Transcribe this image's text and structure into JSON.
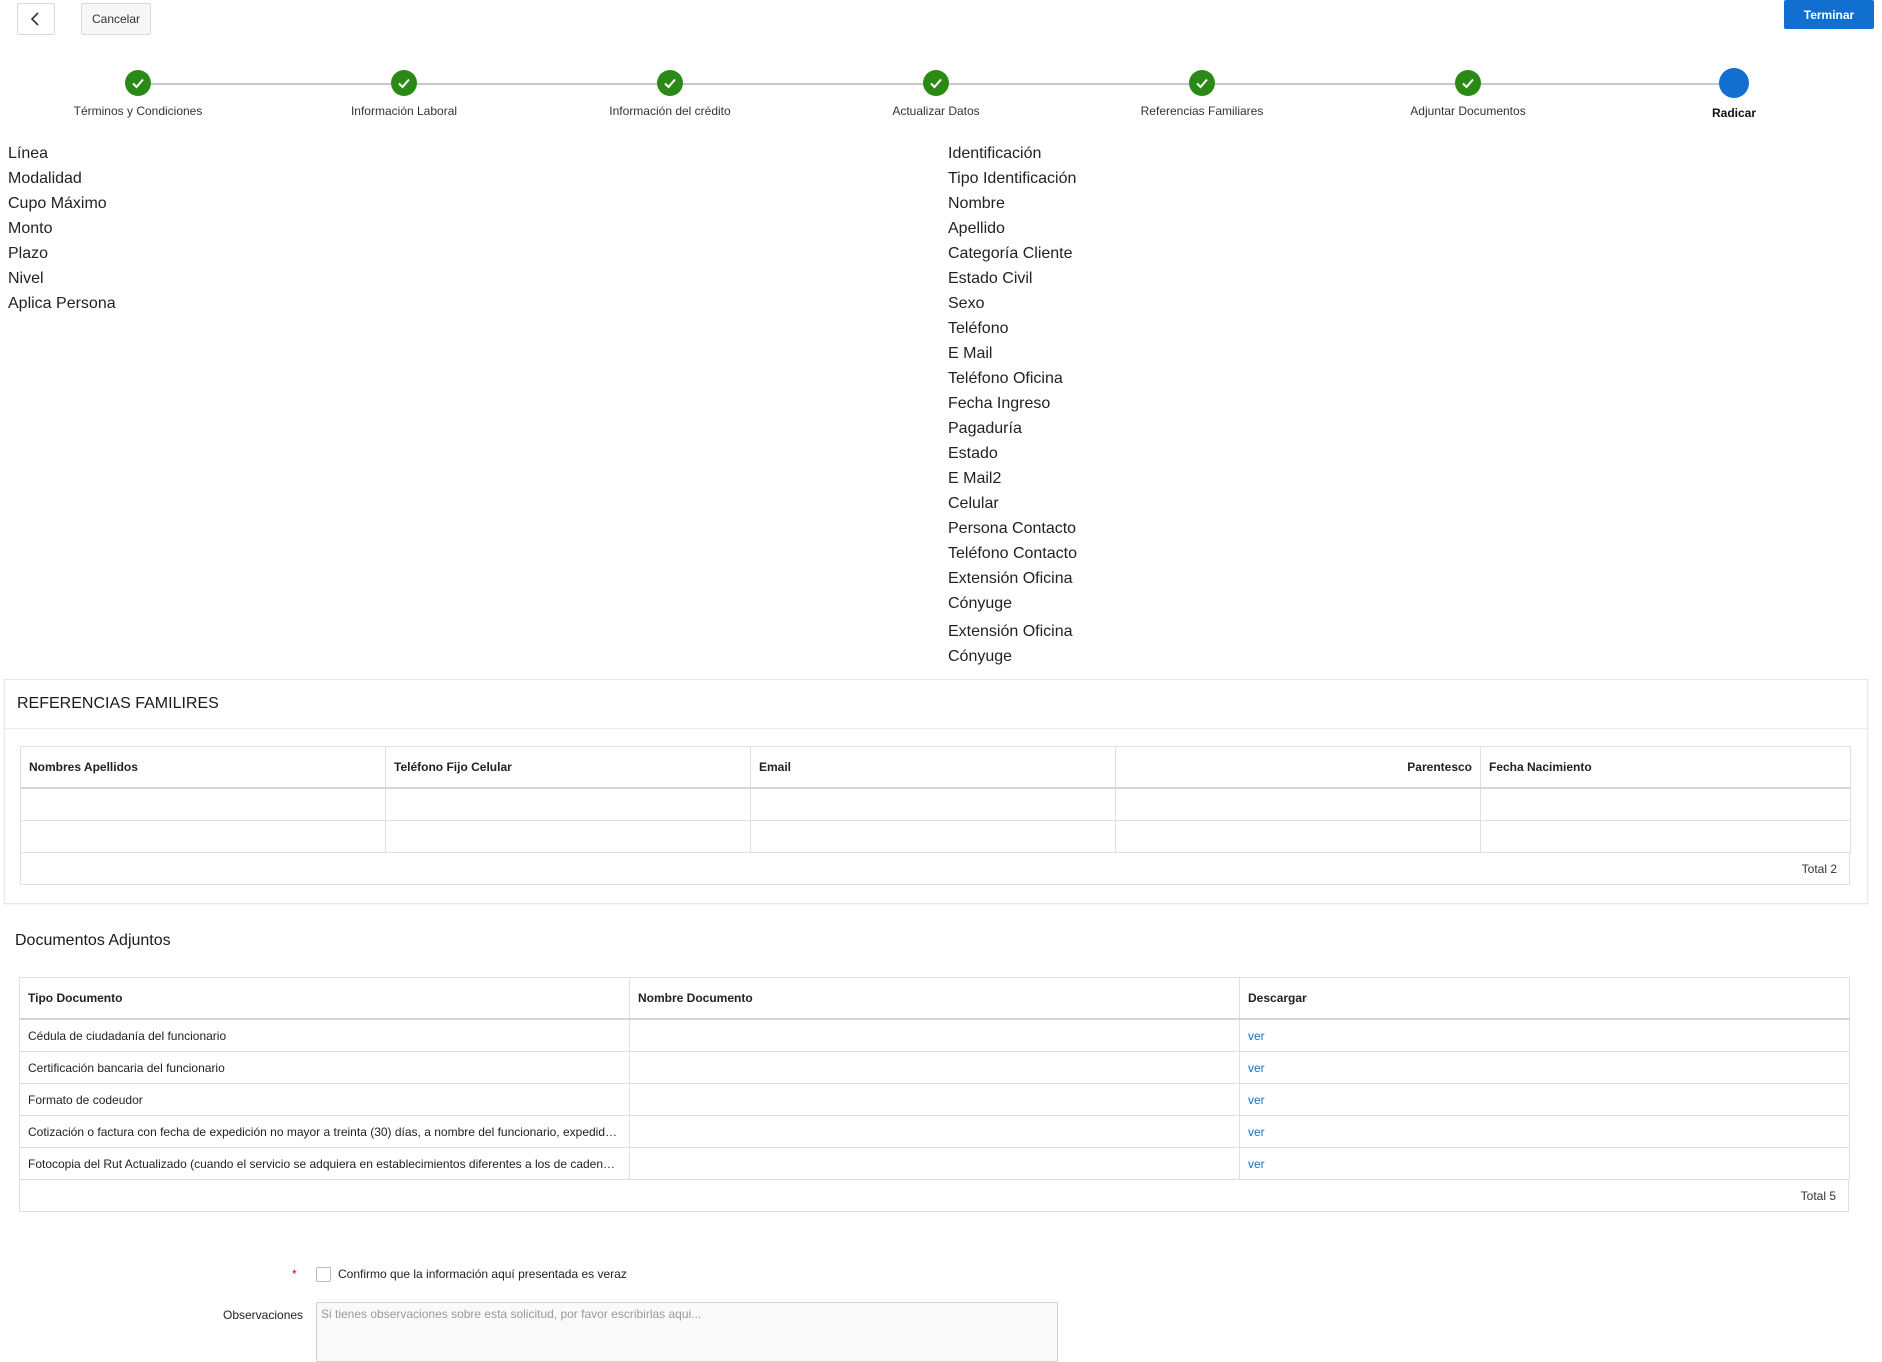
{
  "toolbar": {
    "cancel_label": "Cancelar",
    "finish_label": "Terminar"
  },
  "stepper": {
    "steps": [
      {
        "label": "Términos y Condiciones",
        "state": "done"
      },
      {
        "label": "Información Laboral",
        "state": "done"
      },
      {
        "label": "Información del crédito",
        "state": "done"
      },
      {
        "label": "Actualizar Datos",
        "state": "done"
      },
      {
        "label": "Referencias Familiares",
        "state": "done"
      },
      {
        "label": "Adjuntar Documentos",
        "state": "done"
      },
      {
        "label": "Radicar",
        "state": "current"
      }
    ]
  },
  "credit_fields": [
    "Línea",
    "Modalidad",
    "Cupo Máximo",
    "Monto",
    "Plazo",
    "Nivel",
    "Aplica Persona"
  ],
  "client_fields": [
    "Identificación",
    "Tipo Identificación",
    "Nombre",
    "Apellido",
    "Categoría Cliente",
    "Estado Civil",
    "Sexo",
    "Teléfono",
    "E Mail",
    "Teléfono Oficina",
    "Fecha Ingreso",
    "Pagaduría",
    "Estado",
    "E Mail2",
    "Celular",
    "Persona Contacto",
    "Teléfono Contacto",
    "Extensión Oficina",
    "Cónyuge",
    "Extensión Oficina",
    "Cónyuge"
  ],
  "references": {
    "title": "REFERENCIAS FAMILIRES",
    "columns": [
      "Nombres Apellidos",
      "Teléfono Fijo Celular",
      "Email",
      "Parentesco",
      "Fecha Nacimiento"
    ],
    "rows": [
      [
        "",
        "",
        "",
        "",
        ""
      ],
      [
        "",
        "",
        "",
        "",
        ""
      ]
    ],
    "total": "Total 2"
  },
  "documents": {
    "title": "Documentos Adjuntos",
    "columns": [
      "Tipo Documento",
      "Nombre Documento",
      "Descargar"
    ],
    "rows": [
      {
        "type": "Cédula de ciudadanía del funcionario",
        "name": "",
        "link": "ver"
      },
      {
        "type": "Certificación bancaria del funcionario",
        "name": "",
        "link": "ver"
      },
      {
        "type": "Formato de codeudor",
        "name": "",
        "link": "ver"
      },
      {
        "type": "Cotización o factura con fecha de expedición no mayor a treinta (30) días, a nombre del funcionario, expedida ...",
        "name": "",
        "link": "ver"
      },
      {
        "type": "Fotocopia del Rut Actualizado (cuando el servicio se adquiera en establecimientos diferentes a los de cadena ...",
        "name": "",
        "link": "ver"
      }
    ],
    "total": "Total 5"
  },
  "form": {
    "required_mark": "*",
    "confirm_label": "Confirmo que la información aquí presentada es veraz",
    "observations_label": "Observaciones",
    "observations_placeholder": "Si tienes observaciones sobre esta solicitud, por favor escribirlas aqui..."
  }
}
